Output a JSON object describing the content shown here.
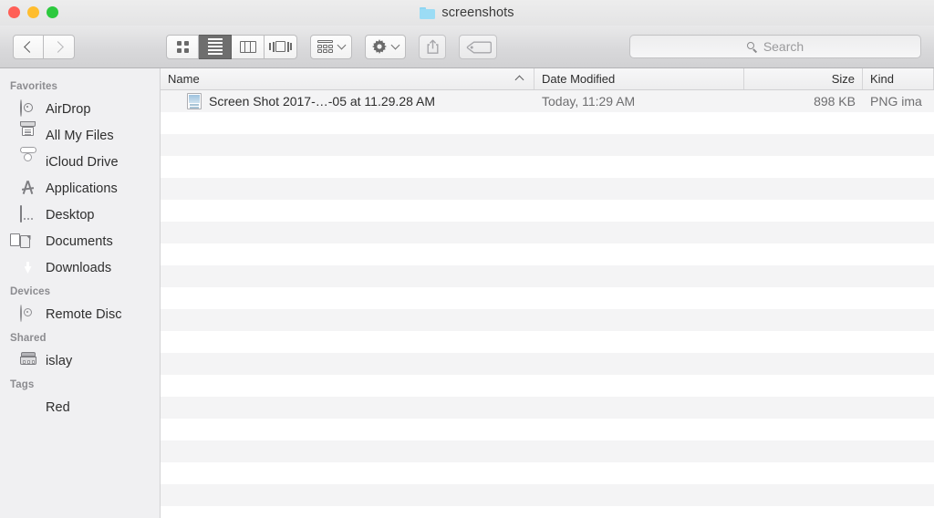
{
  "window": {
    "title": "screenshots",
    "folder_icon": "folder-icon",
    "traffic_lights": [
      {
        "name": "close-button",
        "color": "#FF5F57"
      },
      {
        "name": "minimize-button",
        "color": "#FFBD2E"
      },
      {
        "name": "maximize-button",
        "color": "#2CC93E"
      }
    ]
  },
  "toolbar": {
    "back_icon": "chevron-left-icon",
    "forward_icon": "chevron-right-icon",
    "view_modes": [
      {
        "name": "icon-view",
        "icon": "grid-icon",
        "selected": false
      },
      {
        "name": "list-view",
        "icon": "list-icon",
        "selected": true
      },
      {
        "name": "column-view",
        "icon": "columns-icon",
        "selected": false
      },
      {
        "name": "coverflow-view",
        "icon": "coverflow-icon",
        "selected": false
      }
    ],
    "arrange_icon": "arrange-by-icon",
    "action_icon": "gear-icon",
    "share_icon": "share-icon",
    "tags_icon": "tag-icon",
    "dropdown_icon": "chevron-down-icon"
  },
  "search": {
    "placeholder": "Search",
    "value": "",
    "icon": "search-icon"
  },
  "sidebar": {
    "sections": [
      {
        "title": "Favorites",
        "items": [
          {
            "label": "AirDrop",
            "icon": "airdrop-icon"
          },
          {
            "label": "All My Files",
            "icon": "all-my-files-icon"
          },
          {
            "label": "iCloud Drive",
            "icon": "icloud-icon"
          },
          {
            "label": "Applications",
            "icon": "applications-icon"
          },
          {
            "label": "Desktop",
            "icon": "desktop-icon"
          },
          {
            "label": "Documents",
            "icon": "documents-icon"
          },
          {
            "label": "Downloads",
            "icon": "downloads-icon"
          }
        ]
      },
      {
        "title": "Devices",
        "items": [
          {
            "label": "Remote Disc",
            "icon": "remote-disc-icon"
          }
        ]
      },
      {
        "title": "Shared",
        "items": [
          {
            "label": "islay",
            "icon": "server-icon"
          }
        ]
      },
      {
        "title": "Tags",
        "items": [
          {
            "label": "Red",
            "icon": "tag-dot-icon",
            "color": "#F8574F"
          }
        ]
      }
    ]
  },
  "filelist": {
    "columns": [
      {
        "key": "name",
        "label": "Name",
        "sorted": true,
        "sort_icon": "chevron-up-icon"
      },
      {
        "key": "date",
        "label": "Date Modified",
        "sorted": false
      },
      {
        "key": "size",
        "label": "Size",
        "sorted": false
      },
      {
        "key": "kind",
        "label": "Kind",
        "sorted": false
      }
    ],
    "rows": [
      {
        "icon": "png-thumbnail-icon",
        "name": "Screen Shot 2017-…-05 at 11.29.28 AM",
        "date": "Today, 11:29 AM",
        "size": "898 KB",
        "kind": "PNG ima"
      }
    ],
    "empty_row_count": 18
  }
}
